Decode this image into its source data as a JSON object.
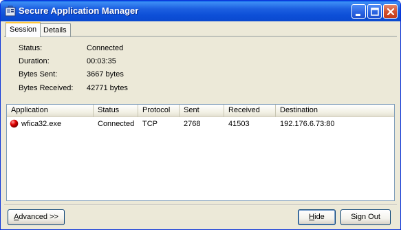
{
  "window": {
    "title": "Secure Application Manager"
  },
  "tabs": [
    {
      "label": "Session",
      "active": true
    },
    {
      "label": "Details",
      "active": false
    }
  ],
  "session": {
    "status_label": "Status:",
    "status_value": "Connected",
    "duration_label": "Duration:",
    "duration_value": "00:03:35",
    "bytes_sent_label": "Bytes Sent:",
    "bytes_sent_value": "3667 bytes",
    "bytes_received_label": "Bytes Received:",
    "bytes_received_value": "42771 bytes"
  },
  "table": {
    "columns": [
      "Application",
      "Status",
      "Protocol",
      "Sent",
      "Received",
      "Destination"
    ],
    "rows": [
      {
        "application": "wfica32.exe",
        "status": "Connected",
        "protocol": "TCP",
        "sent": "2768",
        "received": "41503",
        "destination": "192.176.6.73:80"
      }
    ]
  },
  "buttons": {
    "advanced_prefix": "A",
    "advanced_rest": "dvanced >>",
    "hide_prefix": "H",
    "hide_rest": "ide",
    "signout": "Sign Out"
  },
  "colors": {
    "titlebar": "#0a49cf",
    "window_bg": "#ece9d8",
    "close_button": "#d2512f",
    "app_icon": "#d40000"
  }
}
